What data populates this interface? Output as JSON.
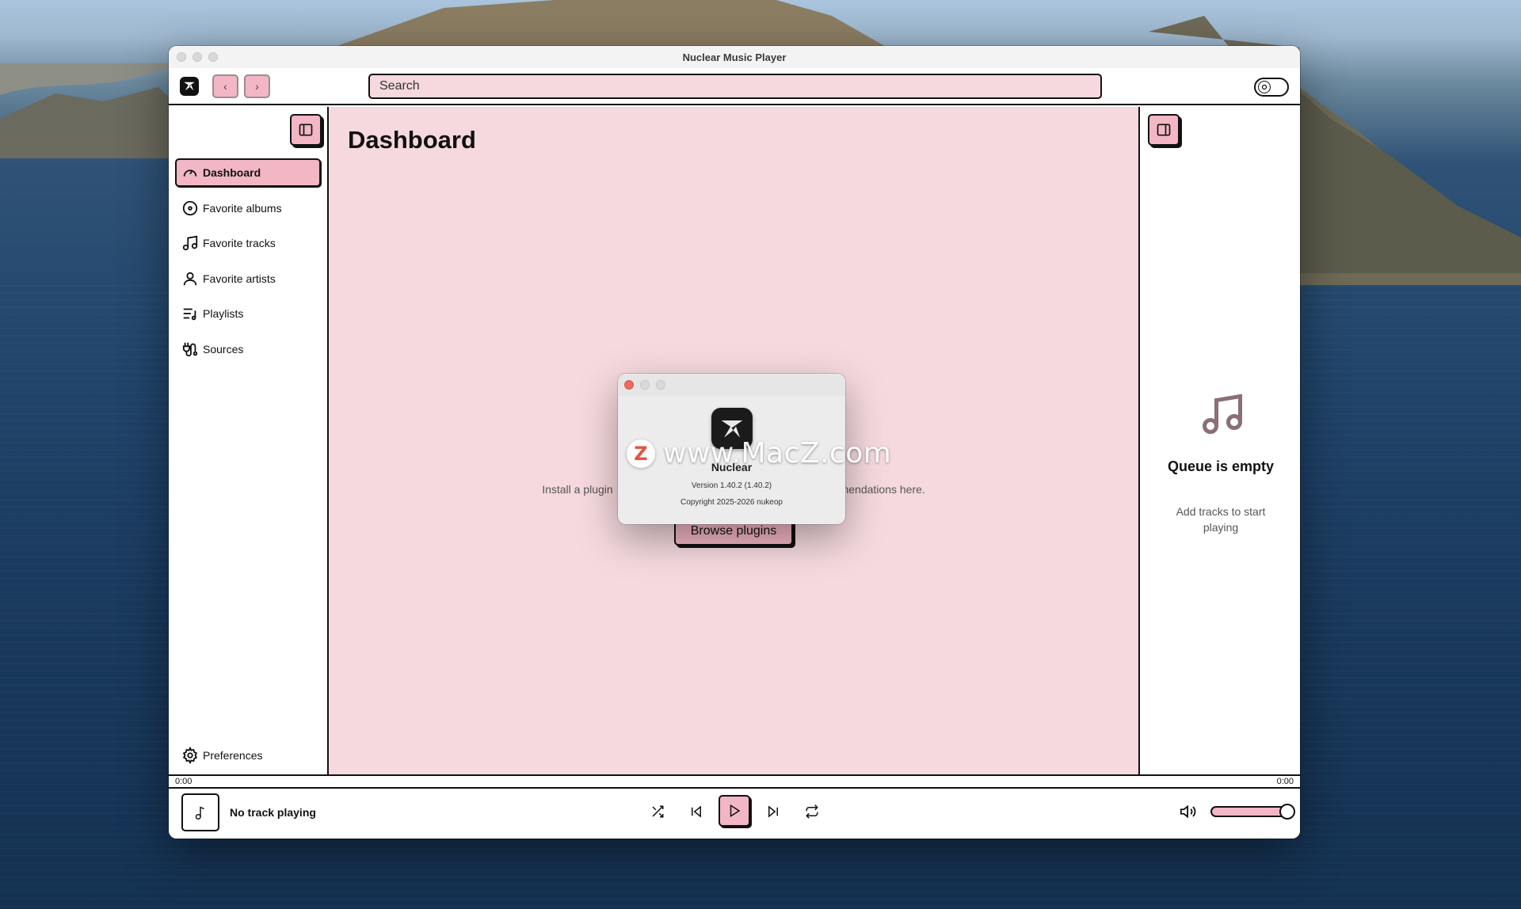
{
  "window": {
    "title": "Nuclear Music Player"
  },
  "toolbar": {
    "back_glyph": "‹",
    "forward_glyph": "›",
    "search_placeholder": "Search"
  },
  "sidebar": {
    "items": [
      {
        "label": "Dashboard",
        "icon": "gauge-icon",
        "active": true
      },
      {
        "label": "Favorite albums",
        "icon": "disc-icon"
      },
      {
        "label": "Favorite tracks",
        "icon": "music-note-icon"
      },
      {
        "label": "Favorite artists",
        "icon": "user-icon"
      },
      {
        "label": "Playlists",
        "icon": "playlist-icon"
      },
      {
        "label": "Sources",
        "icon": "plug-icon"
      }
    ],
    "preferences_label": "Preferences"
  },
  "main": {
    "title": "Dashboard",
    "empty_text_left": "Install a plugin",
    "empty_text_right": "nendations here.",
    "browse_button": "Browse plugins"
  },
  "queue": {
    "title": "Queue is empty",
    "subtitle": "Add tracks to start playing"
  },
  "player": {
    "time_elapsed": "0:00",
    "time_total": "0:00",
    "now_playing": "No track playing",
    "volume": 1.0
  },
  "about": {
    "app_name": "Nuclear",
    "version": "Version 1.40.2 (1.40.2)",
    "copyright": "Copyright 2025-2026 nukeop"
  },
  "watermark": {
    "text": "www.MacZ.com",
    "badge": "Z"
  },
  "colors": {
    "accent_pink": "#f2b6c4",
    "content_bg": "#f5d9de",
    "border": "#111111"
  }
}
